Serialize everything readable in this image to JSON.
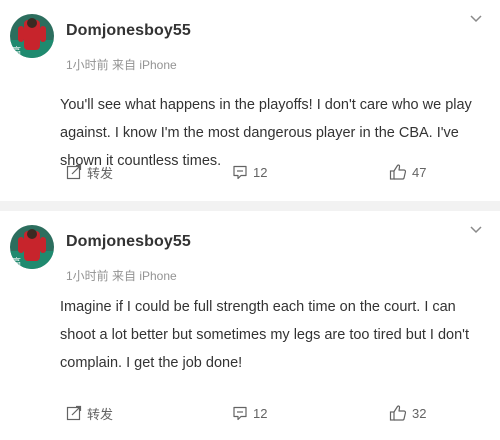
{
  "posts": [
    {
      "username": "Domjonesboy55",
      "meta": "1小时前 来自 iPhone",
      "text": "You'll see what happens in the playoffs! I don't care who we play against. I know I'm the most dangerous player in the CBA. I've shown it countless times.",
      "repost_label": "转发",
      "comment_count": "12",
      "like_count": "47"
    },
    {
      "username": "Domjonesboy55",
      "meta": "1小时前 来自 iPhone",
      "text": "Imagine if I could be full strength each time on the court. I can shoot a lot better but sometimes my legs are too tired but I don't complain. I get the job done!",
      "repost_label": "转发",
      "comment_count": "12",
      "like_count": "32"
    }
  ],
  "icons": {
    "menu": "chevron-down-icon",
    "repost": "share-icon",
    "comment": "comment-icon",
    "like": "thumbs-up-icon"
  },
  "colors": {
    "page_background": "#f2f2f2",
    "card_background": "#ffffff",
    "username": "#333333",
    "meta": "#939393",
    "action": "#636363"
  }
}
